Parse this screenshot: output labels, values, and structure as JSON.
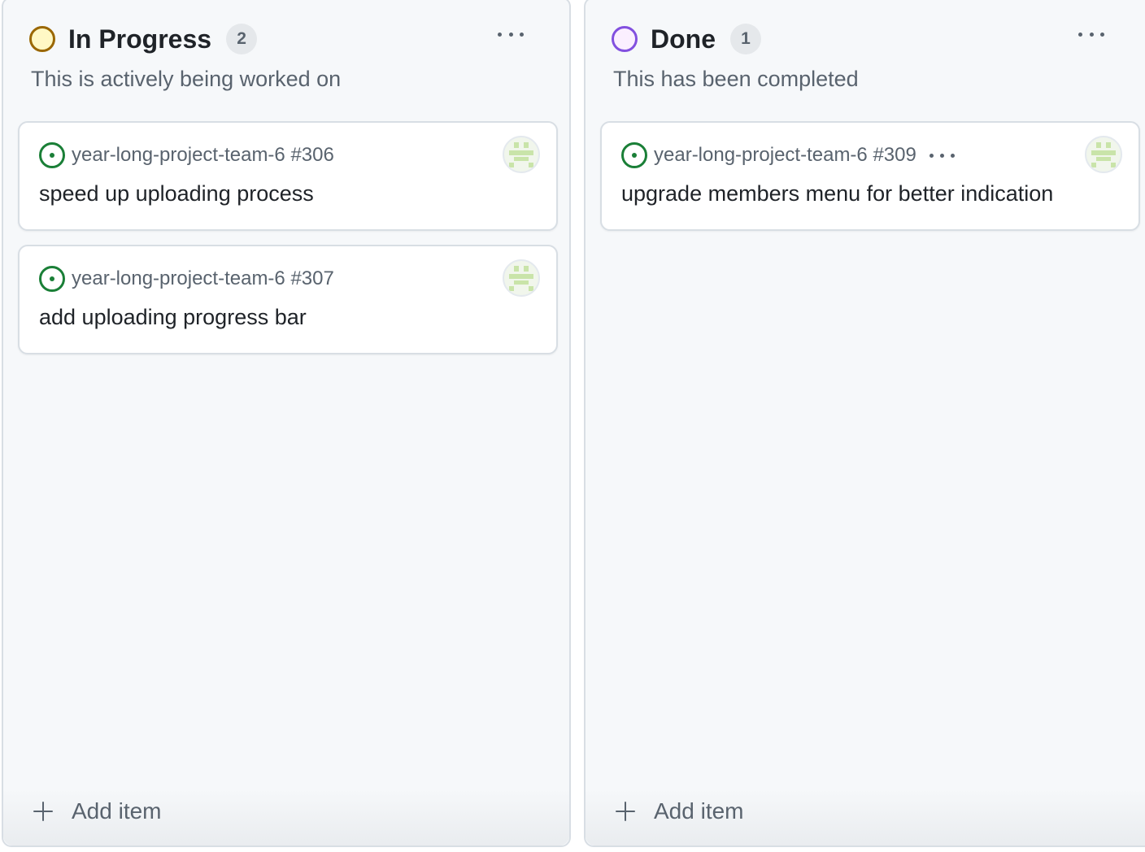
{
  "columns": [
    {
      "title": "In Progress",
      "count": "2",
      "status_color": "#9a6700",
      "description": "This is actively being worked on",
      "add_item_label": "Add item",
      "cards": [
        {
          "ref": "year-long-project-team-6 #306",
          "title": "speed up uploading process"
        },
        {
          "ref": "year-long-project-team-6 #307",
          "title": "add uploading progress bar"
        }
      ]
    },
    {
      "title": "Done",
      "count": "1",
      "status_color": "#8250df",
      "description": "This has been completed",
      "add_item_label": "Add item",
      "cards": [
        {
          "ref": "year-long-project-team-6 #309",
          "title": "upgrade members menu for better indication"
        }
      ]
    }
  ],
  "icons": {
    "issue": "issue-opened-icon",
    "menu": "kebab-horizontal-icon",
    "add": "plus-icon",
    "avatar": "identicon-avatar"
  }
}
